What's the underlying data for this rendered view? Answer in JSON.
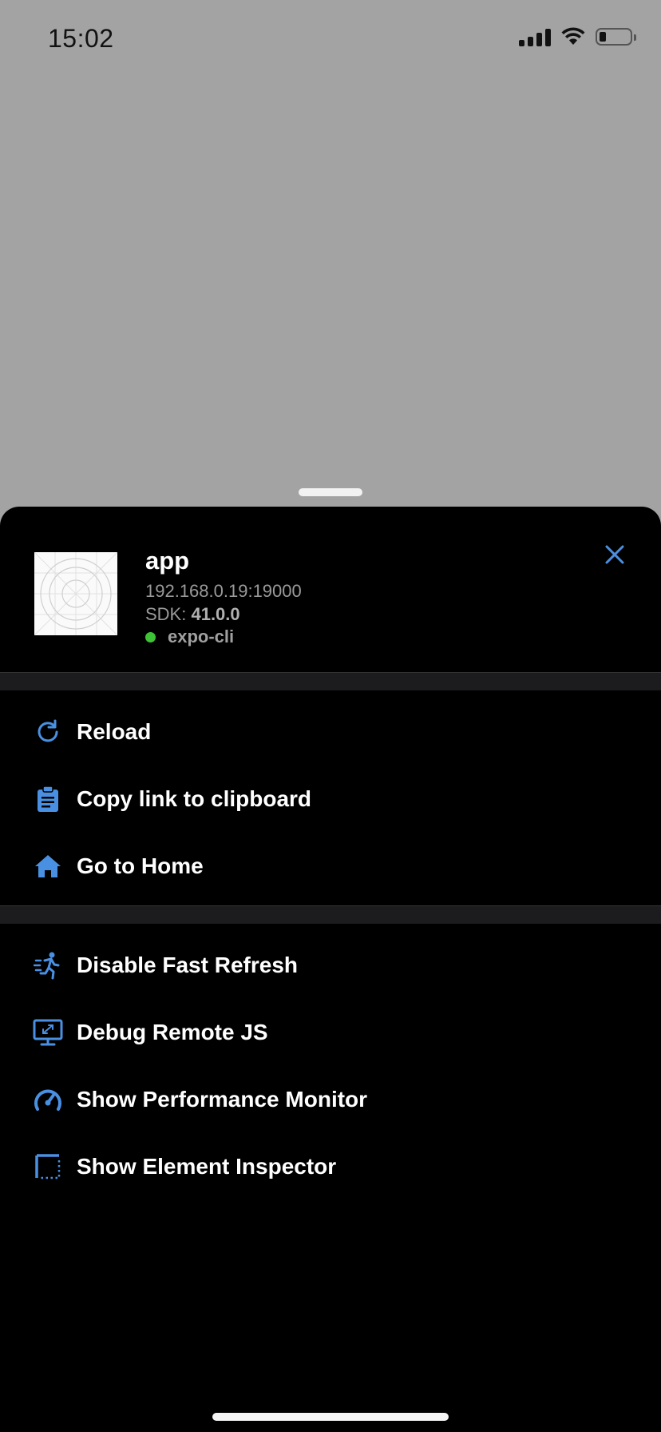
{
  "status_bar": {
    "time": "15:02"
  },
  "app": {
    "name": "app",
    "host": "192.168.0.19:19000",
    "sdk_label": "SDK: ",
    "sdk_version": "41.0.0",
    "source": "expo-cli",
    "source_status_color": "#3ec337"
  },
  "menu": {
    "group1": [
      {
        "label": "Reload",
        "icon": "reload-icon"
      },
      {
        "label": "Copy link to clipboard",
        "icon": "clipboard-icon"
      },
      {
        "label": "Go to Home",
        "icon": "home-icon"
      }
    ],
    "group2": [
      {
        "label": "Disable Fast Refresh",
        "icon": "running-person-icon"
      },
      {
        "label": "Debug Remote JS",
        "icon": "remote-debug-icon"
      },
      {
        "label": "Show Performance Monitor",
        "icon": "speedometer-icon"
      },
      {
        "label": "Show Element Inspector",
        "icon": "inspector-icon"
      }
    ]
  },
  "colors": {
    "accent": "#4a90e2",
    "sheet_bg": "#000000",
    "backdrop": "#a3a3a3"
  }
}
